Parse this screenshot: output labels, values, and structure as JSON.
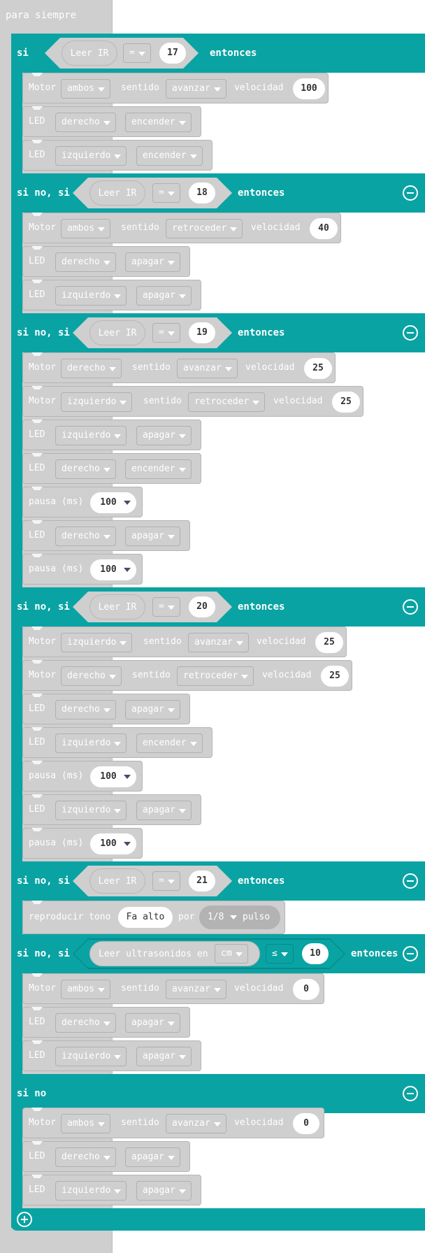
{
  "forever_label": "para siempre",
  "kw": {
    "si": "si",
    "sinosi": "si no, si",
    "sino": "si no",
    "entonces": "entonces"
  },
  "ir": {
    "label": "Leer IR",
    "op": "="
  },
  "values": {
    "v17": "17",
    "v18": "18",
    "v19": "19",
    "v20": "20",
    "v21": "21"
  },
  "labels": {
    "motor": "Motor",
    "led": "LED",
    "sentido": "sentido",
    "velocidad": "velocidad",
    "pausa": "pausa (ms)"
  },
  "opt": {
    "ambos": "ambos",
    "derecho": "derecho",
    "izquierdo": "izquierdo",
    "avanzar": "avanzar",
    "retroceder": "retroceder",
    "encender": "encender",
    "apagar": "apagar"
  },
  "speeds": {
    "s100": "100",
    "s40": "40",
    "s25": "25",
    "s0": "0"
  },
  "pause_val": "100",
  "tone": {
    "label": "reproducir tono",
    "note": "Fa alto",
    "por": "por",
    "beat": "1/8",
    "pulso": "pulso"
  },
  "ultra": {
    "label": "Leer ultrasonidos en",
    "unit": "cm",
    "op": "≤",
    "value": "10"
  },
  "colors": {
    "logic": "#0aa3a3",
    "block": "#cfcfcf"
  }
}
